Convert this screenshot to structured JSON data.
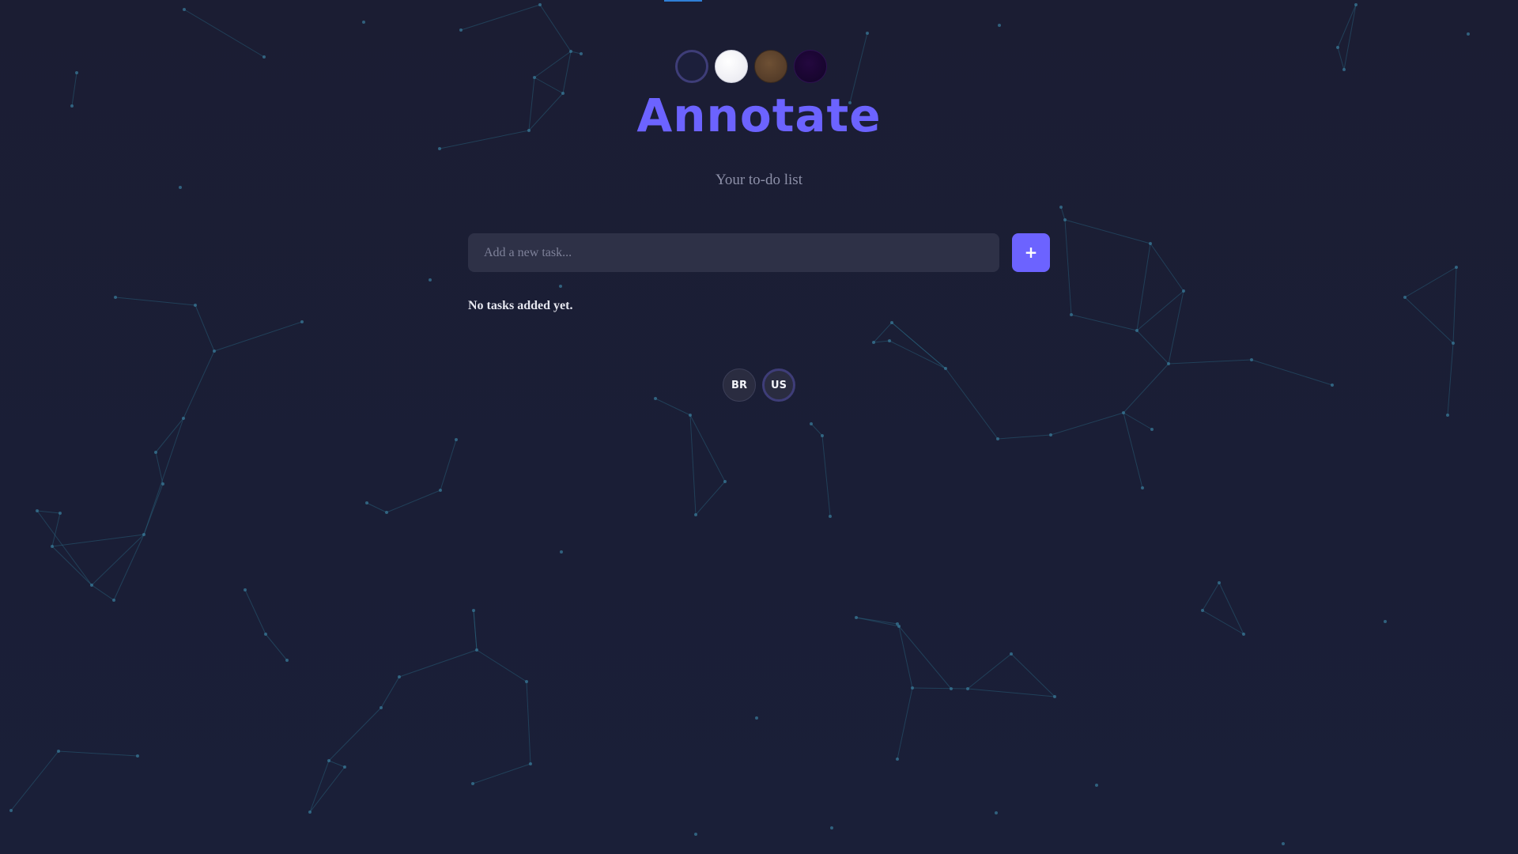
{
  "app": {
    "title": "Annotate",
    "subtitle": "Your to-do list"
  },
  "themes": [
    {
      "name": "dark",
      "color": "#1c1f3b",
      "selected": true
    },
    {
      "name": "light",
      "color": "#f5f5fa",
      "selected": false
    },
    {
      "name": "brown",
      "color": "#5c4130",
      "selected": false
    },
    {
      "name": "purple",
      "color": "#1a0632",
      "selected": false
    }
  ],
  "task_form": {
    "input_placeholder": "Add a new task...",
    "input_value": "",
    "add_button_label": "+"
  },
  "tasks": {
    "empty_message": "No tasks added yet."
  },
  "languages": [
    {
      "code": "BR",
      "active": false
    },
    {
      "code": "US",
      "active": true
    }
  ],
  "colors": {
    "accent": "#6c63ff",
    "background": "#1b1d33",
    "input_background": "#2e3147",
    "network_line": "#2a6a86"
  }
}
